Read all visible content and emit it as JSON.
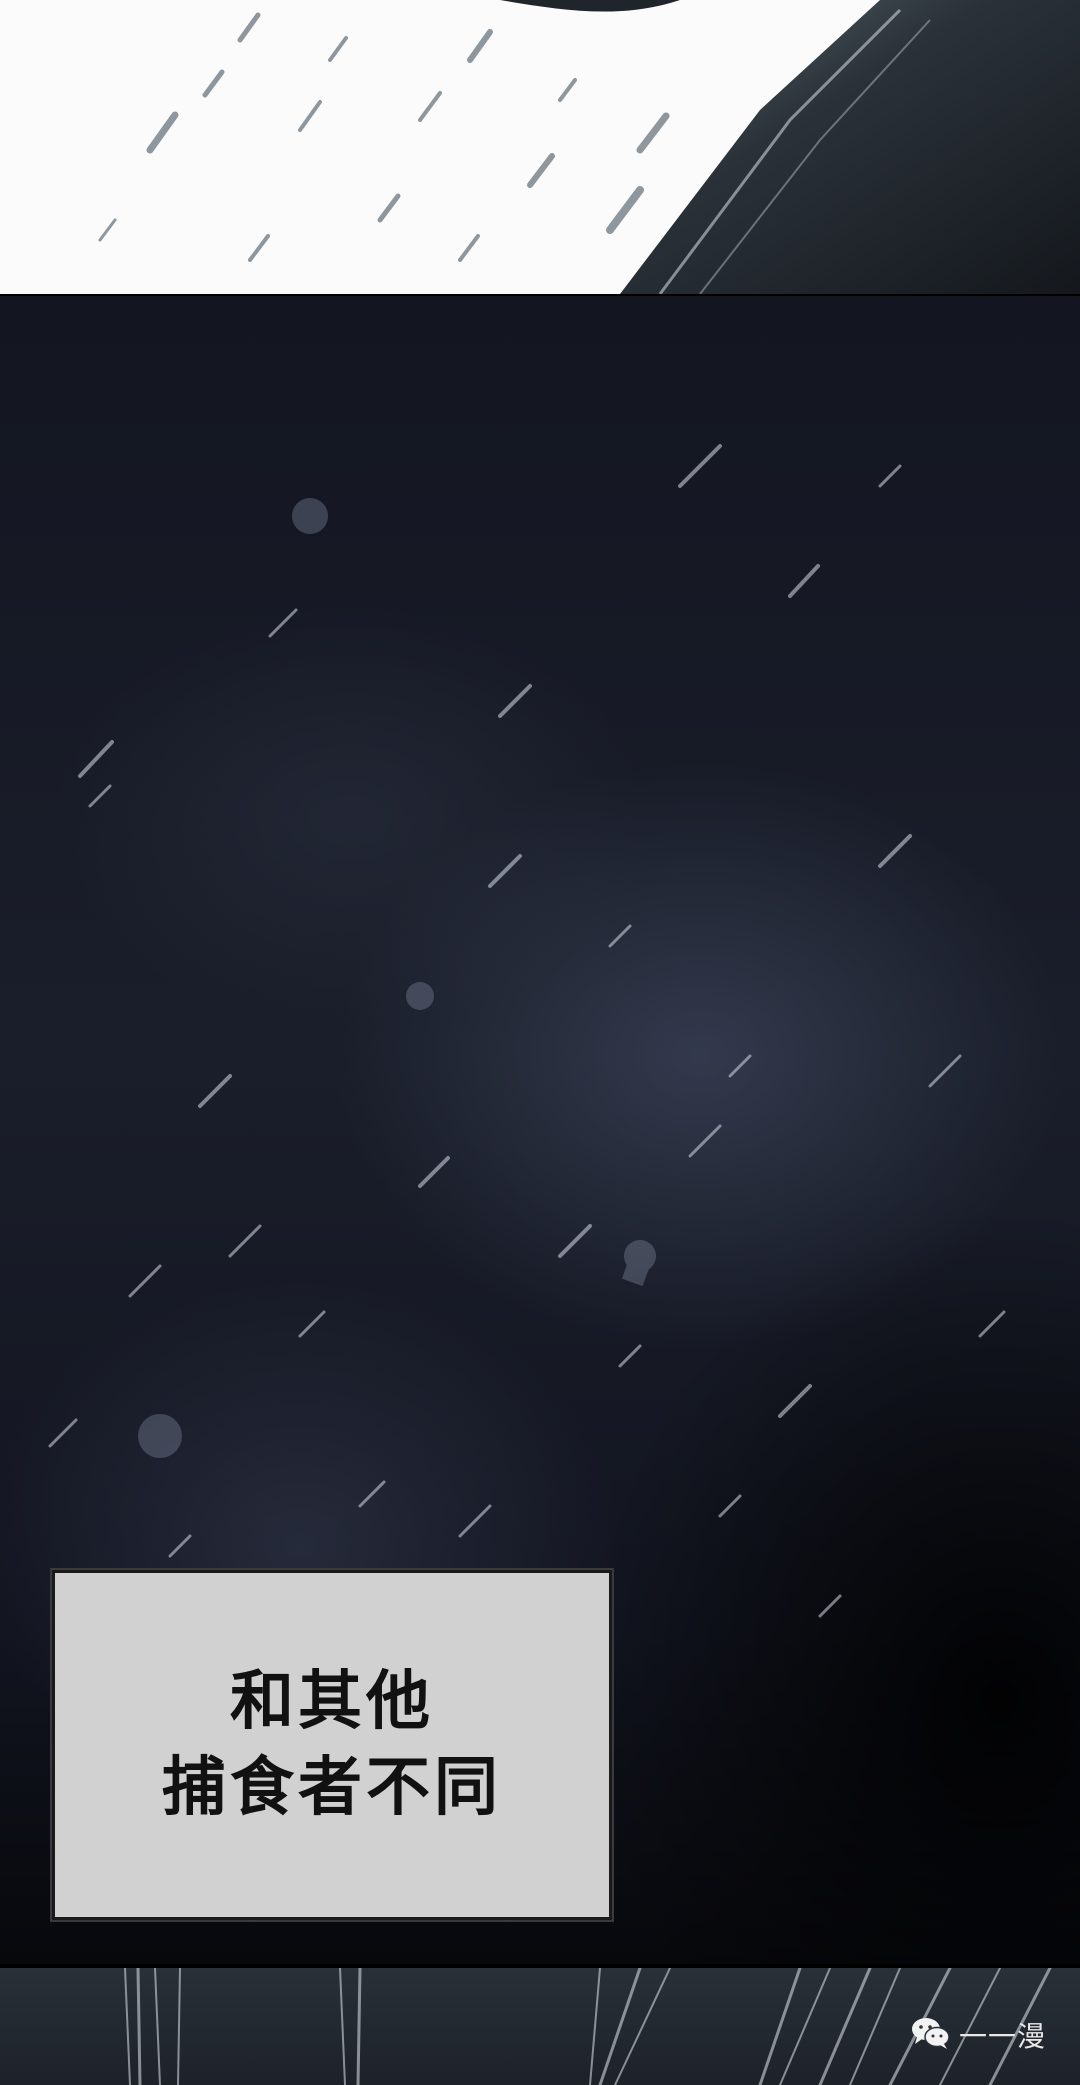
{
  "caption": {
    "lines": [
      "和其他",
      "捕食者不同"
    ]
  },
  "watermark": {
    "icon": "wechat-icon",
    "text": "一一漫"
  },
  "colors": {
    "caption_bg": "#d1d1d1",
    "night_sky": "#1a1e2a",
    "top_panel_bg": "#fbfbfb"
  }
}
